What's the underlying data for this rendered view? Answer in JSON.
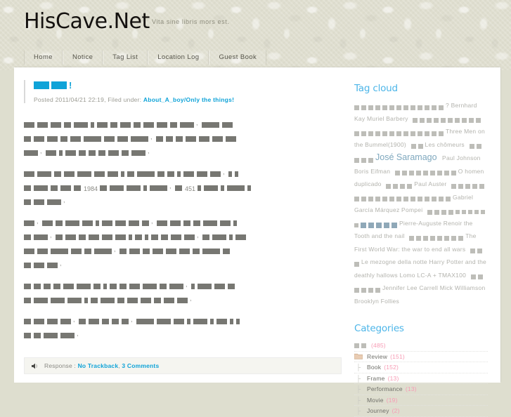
{
  "site": {
    "title": "HisCave.Net",
    "tagline": "Vita sine libris mors est.",
    "nav": [
      "Home",
      "Notice",
      "Tag List",
      "Location Log",
      "Guest Book"
    ]
  },
  "colors": {
    "accent_blue": "#0fa3d8",
    "heading_blue": "#4cb5e8",
    "count_pink": "#f79bb4",
    "wallpaper": "#dedecf",
    "redacted_block": "#777772",
    "tag_block": "#bdbdb8",
    "tag_block_blue": "#8fa8b8",
    "tag_big_text": "#7fa8be"
  },
  "post": {
    "title_bang": "!",
    "title_blocks": [
      22,
      22,
      0
    ],
    "meta_prefix": "Posted 2011/04/21 22:19, Filed under:",
    "meta_link": "About_A_boy/Only the things!",
    "body": [
      [
        [
          15,
          15,
          15,
          10,
          20,
          5,
          15,
          10,
          15,
          10,
          15,
          15,
          10,
          20,
          ",",
          25,
          15
        ],
        [
          10,
          15,
          15,
          10,
          15,
          25,
          15,
          15,
          25,
          ",",
          10,
          10,
          10,
          15,
          15,
          15,
          15
        ],
        [
          20,
          ",",
          15,
          5,
          15,
          10,
          10,
          10,
          15,
          10,
          20,
          ","
        ]
      ],
      [
        [
          15,
          20,
          10,
          15,
          20,
          15,
          15,
          5,
          10,
          25,
          10,
          10,
          5,
          15,
          15,
          15,
          ",",
          5,
          5
        ],
        [
          10,
          20,
          10,
          15,
          10,
          "1984",
          10,
          20,
          20,
          5,
          25,
          ",",
          10,
          "451",
          5,
          20,
          5,
          25,
          5
        ],
        [
          10,
          15,
          20,
          ","
        ]
      ],
      [
        [
          15,
          ",",
          15,
          10,
          20,
          15,
          5,
          15,
          15,
          15,
          10,
          ",",
          15,
          15,
          10,
          10,
          20,
          15,
          5
        ],
        [
          10,
          20,
          ",",
          10,
          15,
          10,
          15,
          15,
          15,
          5,
          10,
          5,
          10,
          10,
          15,
          15,
          ",",
          10,
          20,
          5,
          15
        ],
        [
          15,
          15,
          25,
          15,
          10,
          25,
          ",",
          10,
          15,
          10,
          15,
          15,
          15,
          10,
          25,
          10
        ],
        [
          10,
          15,
          15,
          ","
        ]
      ],
      [
        [
          10,
          10,
          10,
          10,
          15,
          20,
          10,
          5,
          10,
          10,
          15,
          20,
          10,
          20,
          ",",
          5,
          20,
          15,
          10
        ],
        [
          10,
          20,
          20,
          20,
          5,
          10,
          20,
          10,
          15,
          15,
          10,
          15,
          15,
          ","
        ]
      ],
      [
        [
          10,
          15,
          15,
          15,
          ",",
          10,
          15,
          10,
          10,
          10,
          ",",
          25,
          20,
          15,
          5,
          20,
          5,
          15,
          5,
          5
        ],
        [
          10,
          10,
          20,
          20,
          ","
        ]
      ]
    ],
    "response_label": "Response :",
    "response_trackback": "No Trackback",
    "response_sep": ",",
    "response_comments": "3 Comments",
    "speaker_icon": "speaker-icon"
  },
  "sidebar": {
    "tagcloud_heading": "Tag cloud",
    "tags": [
      {
        "type": "blocks",
        "sizes": [
          7,
          7,
          7,
          7
        ],
        "style": "plain"
      },
      {
        "type": "blocks",
        "sizes": [
          7,
          7
        ],
        "style": "plain"
      },
      {
        "type": "blocks",
        "sizes": [
          7,
          7,
          7
        ],
        "style": "plain"
      },
      {
        "type": "blocks",
        "sizes": [
          7,
          7,
          7,
          7
        ],
        "style": "plain"
      },
      {
        "type": "text",
        "label": "? Bernhard Kay Muriel Barbery",
        "size": "small"
      },
      {
        "type": "blocks",
        "sizes": [
          7,
          7,
          7,
          7,
          7,
          7
        ],
        "style": "plain"
      },
      {
        "type": "blocks",
        "sizes": [
          7,
          7,
          7
        ],
        "style": "plain"
      },
      {
        "type": "blocks",
        "sizes": [
          7
        ],
        "style": "plain"
      },
      {
        "type": "blocks",
        "sizes": [
          7
        ],
        "style": "plain"
      },
      {
        "type": "blocks",
        "sizes": [
          7,
          7,
          7,
          7,
          7
        ],
        "style": "plain"
      },
      {
        "type": "blocks",
        "sizes": [
          7,
          7,
          7
        ],
        "style": "plain"
      },
      {
        "type": "blocks",
        "sizes": [
          7,
          7,
          7,
          7
        ],
        "style": "plain"
      },
      {
        "type": "text",
        "label": "Three Men on the Bummel(1900)",
        "size": "small"
      },
      {
        "type": "blocks",
        "sizes": [
          7,
          7
        ],
        "style": "plain"
      },
      {
        "type": "text",
        "label": "Les chômeurs",
        "size": "small"
      },
      {
        "type": "blocks",
        "sizes": [
          7
        ],
        "style": "plain"
      },
      {
        "type": "blocks",
        "sizes": [
          7,
          7
        ],
        "style": "plain"
      },
      {
        "type": "blocks",
        "sizes": [
          7,
          7
        ],
        "style": "plain"
      },
      {
        "type": "text",
        "label": "José Saramago",
        "size": "big"
      },
      {
        "type": "text",
        "label": "Paul Johnson Boris Eifman",
        "size": "small"
      },
      {
        "type": "blocks",
        "sizes": [
          7,
          7
        ],
        "style": "plain"
      },
      {
        "type": "blocks",
        "sizes": [
          7,
          7
        ],
        "style": "plain"
      },
      {
        "type": "blocks",
        "sizes": [
          7,
          7,
          7
        ],
        "style": "plain"
      },
      {
        "type": "blocks",
        "sizes": [
          7,
          7
        ],
        "style": "plain"
      },
      {
        "type": "text",
        "label": "O homen duplicado",
        "size": "small"
      },
      {
        "type": "blocks",
        "sizes": [
          7,
          7
        ],
        "style": "plain"
      },
      {
        "type": "blocks",
        "sizes": [
          7,
          7
        ],
        "style": "plain"
      },
      {
        "type": "text",
        "label": "Paul Auster",
        "size": "small"
      },
      {
        "type": "blocks",
        "sizes": [
          7,
          7,
          7,
          7
        ],
        "style": "plain"
      },
      {
        "type": "blocks",
        "sizes": [
          7,
          7,
          7,
          7,
          7
        ],
        "style": "plain"
      },
      {
        "type": "blocks",
        "sizes": [
          7,
          7,
          7
        ],
        "style": "plain"
      },
      {
        "type": "blocks",
        "sizes": [
          7,
          7,
          7
        ],
        "style": "plain"
      },
      {
        "type": "blocks",
        "sizes": [
          7,
          7
        ],
        "style": "plain"
      },
      {
        "type": "blocks",
        "sizes": [
          7,
          7
        ],
        "style": "plain"
      },
      {
        "type": "text",
        "label": "Gabriel García Márquez Pompei",
        "size": "small"
      },
      {
        "type": "blocks",
        "sizes": [
          7,
          7,
          7
        ],
        "style": "plain"
      },
      {
        "type": "blocks",
        "sizes": [
          7
        ],
        "style": "plain"
      },
      {
        "type": "blocks",
        "sizes": [
          6
        ],
        "style": "plain"
      },
      {
        "type": "blocks",
        "sizes": [
          6,
          6
        ],
        "style": "plain"
      },
      {
        "type": "blocks",
        "sizes": [
          6,
          6,
          6
        ],
        "style": "plain"
      },
      {
        "type": "blocks",
        "sizes": [
          8
        ],
        "style": "blue"
      },
      {
        "type": "blocks",
        "sizes": [
          8
        ],
        "style": "blue"
      },
      {
        "type": "blocks",
        "sizes": [
          8,
          8,
          8
        ],
        "style": "blue"
      },
      {
        "type": "text",
        "label": "Pierre-Auguste Renoir the Tooth and the nail",
        "size": "small"
      },
      {
        "type": "blocks",
        "sizes": [
          7
        ],
        "style": "plain"
      },
      {
        "type": "blocks",
        "sizes": [
          7,
          7
        ],
        "style": "plain"
      },
      {
        "type": "blocks",
        "sizes": [
          7,
          7,
          7
        ],
        "style": "plain"
      },
      {
        "type": "blocks",
        "sizes": [
          7
        ],
        "style": "plain"
      },
      {
        "type": "blocks",
        "sizes": [
          7
        ],
        "style": "plain"
      },
      {
        "type": "text",
        "label": "The First World War: the war to end all wars",
        "size": "small"
      },
      {
        "type": "blocks",
        "sizes": [
          7,
          7,
          7
        ],
        "style": "plain"
      },
      {
        "type": "text",
        "label": "Le mezogne della notte Harry Potter and the deathly hallows Lomo LC-A + TMAX100",
        "size": "small"
      },
      {
        "type": "blocks",
        "sizes": [
          7,
          7,
          7,
          7
        ],
        "style": "plain"
      },
      {
        "type": "blocks",
        "sizes": [
          7
        ],
        "style": "plain"
      },
      {
        "type": "blocks",
        "sizes": [
          7
        ],
        "style": "plain"
      },
      {
        "type": "text",
        "label": "Jennifer Lee Carrell Mick Williamson Brooklyn Follies",
        "size": "small"
      }
    ],
    "categories_heading": "Categories",
    "categories": [
      {
        "icon": "none",
        "blocks": [
          7,
          7
        ],
        "label": "",
        "count": "(485)",
        "indent": 0
      },
      {
        "icon": "folder-icon",
        "blocks": [],
        "label": "Review",
        "count": "(151)",
        "indent": 0
      },
      {
        "icon": "tree-branch-icon",
        "blocks": [],
        "label": "Book",
        "count": "(152)",
        "indent": 1
      },
      {
        "icon": "tree-branch-icon",
        "blocks": [],
        "label": "Frame",
        "count": "(13)",
        "indent": 1
      },
      {
        "icon": "tree-branch-icon",
        "blocks": [],
        "label": "Performance",
        "count": "(13)",
        "indent": 1
      },
      {
        "icon": "tree-branch-icon",
        "blocks": [],
        "label": "Movie",
        "count": "(19)",
        "indent": 1
      },
      {
        "icon": "tree-branch-icon",
        "blocks": [],
        "label": "Journey",
        "count": "(2)",
        "indent": 1
      }
    ]
  }
}
